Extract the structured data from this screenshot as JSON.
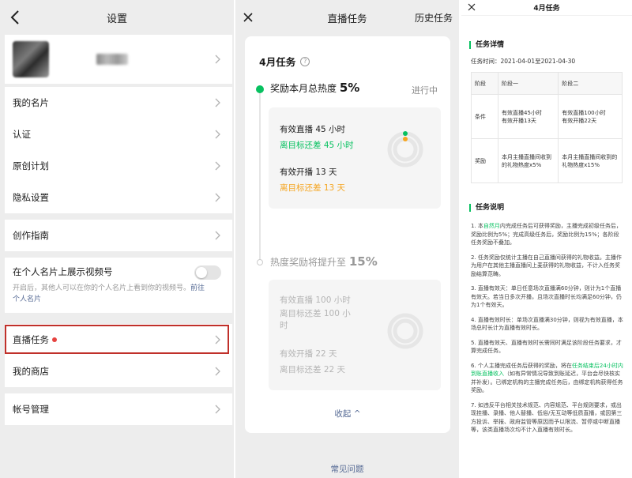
{
  "settings": {
    "title": "设置",
    "items": [
      {
        "label": "我的名片"
      },
      {
        "label": "认证"
      },
      {
        "label": "原创计划"
      },
      {
        "label": "隐私设置"
      },
      {
        "label": "创作指南"
      }
    ],
    "showcase": {
      "label": "在个人名片上展示视频号",
      "desc": "开启后，其他人可以在你的个人名片上看到你的视频号。",
      "link": "前往个人名片"
    },
    "live_task": {
      "label": "直播任务"
    },
    "shop": {
      "label": "我的商店"
    },
    "account": {
      "label": "帐号管理"
    }
  },
  "live": {
    "title": "直播任务",
    "history": "历史任务",
    "card_title": "4月任务",
    "help_icon": "?",
    "stage1": {
      "prefix": "奖励本月总热度",
      "value": "5%",
      "status": "进行中",
      "hours": "有效直播 45 小时",
      "hours_gap": "离目标还差 45 小时",
      "days": "有效开播 13 天",
      "days_gap": "离目标还差 13 天"
    },
    "stage2": {
      "prefix": "热度奖励将提升至",
      "value": "15%",
      "hours": "有效直播 100 小时",
      "hours_gap": "离目标还差 100 小时",
      "days": "有效开播 22 天",
      "days_gap": "离目标还差 22 天"
    },
    "collapse": "收起",
    "faq": "常见问题"
  },
  "details": {
    "title": "4月任务",
    "section1": "任务详情",
    "time": "任务时间：2021-04-01至2021-04-30",
    "table": {
      "headers": [
        "阶段",
        "阶段一",
        "阶段二"
      ],
      "rows": [
        {
          "label": "条件",
          "a1": "有效直播45小时",
          "a2": "有效开播13天",
          "b1": "有效直播100小时",
          "b2": "有效开播22天"
        },
        {
          "label": "奖励",
          "a1": "本月主播直播间收到的礼物热度x5%",
          "b1": "本月主播直播间收到的礼物热度x15%"
        }
      ]
    },
    "section2": "任务说明",
    "rule1_a": "1. 本",
    "rule1_link": "自然月",
    "rule1_b": "内完成任务后可获得奖励，主播完成初级任务后，奖励比例为5%；完成高级任务后，奖励比例为15%；各阶段任务奖励不叠加。",
    "rule2": "2. 任务奖励仅统计主播在自己直播间获得的礼物收益。主播作为用户在其他主播直播间上麦获得的礼物收益，不计入任务奖励结算范畴。",
    "rule3": "3. 直播有效天：单日任意场次直播满60分钟，则计为1个直播有效天。若当日多次开播，且场次直播时长均满足60分钟，仍为1个有效天。",
    "rule4": "4. 直播有效时长：单场次直播满30分钟，则视为有效直播，本场总时长计为直播有效时长。",
    "rule5": "5. 直播有效天、直播有效时长需同时满足该阶段任务要求，才算完成任务。",
    "rule6_a": "6. 个人主播完成任务后获得的奖励，将在",
    "rule6_link": "任务结束后24小时内到账直播收入",
    "rule6_b": "（如有异常情况导致到账延迟，平台会尽快核实并补发）。已绑定机构的主播完成任务后，由绑定机构获得任务奖励。",
    "rule7": "7. 如违反平台相关技术规范、内容规范、平台规则要求，或出现挂播、录播、他人替播、低俗/无互动等低质直播，或因第三方投诉、举报、政府监管等原因而予以限流、暂停或中断直播等，该类直播场次均不计入直播有效时长。"
  },
  "colors": {
    "accent": "#07c160",
    "warning": "#f5a623",
    "link": "#576b95",
    "badge": "#e64340",
    "highlight": "#c0302a"
  }
}
